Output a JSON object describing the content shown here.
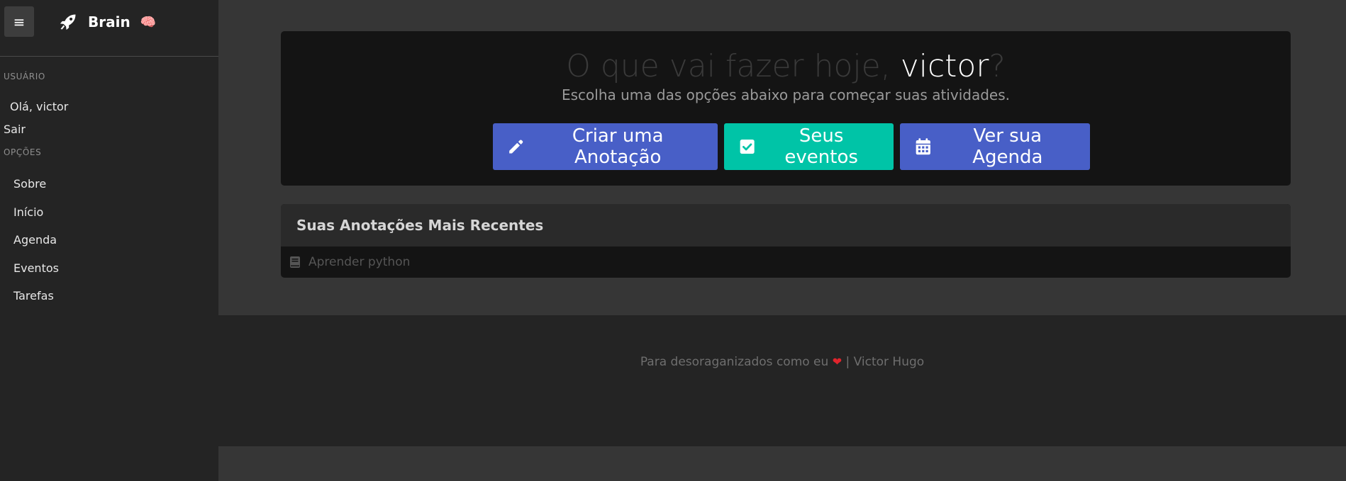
{
  "sidebar": {
    "brand": {
      "title": "Brain",
      "emoji": "🧠"
    },
    "toggle_icon": "≡",
    "user_section_label": "USUÁRIO",
    "greeting": "Olá, victor",
    "logout": "Sair",
    "options_section_label": "OPÇÕES",
    "items": [
      {
        "label": "Sobre"
      },
      {
        "label": "Início"
      },
      {
        "label": "Agenda"
      },
      {
        "label": "Eventos"
      },
      {
        "label": "Tarefas"
      }
    ]
  },
  "hero": {
    "title_prefix": "O que vai fazer hoje, ",
    "user_name": "victor",
    "title_suffix": "?",
    "subtitle": "Escolha uma das opções abaixo para começar suas atividades.",
    "buttons": {
      "note": "Criar uma Anotação",
      "events": "Seus eventos",
      "agenda": "Ver sua Agenda"
    }
  },
  "recent_notes": {
    "title": "Suas Anotações Mais Recentes",
    "items": [
      {
        "label": "Aprender python",
        "icon": "book-icon"
      }
    ]
  },
  "footer": {
    "text": "Para desoraganizados como eu ",
    "heart": "❤",
    "author": " | Victor Hugo"
  },
  "colors": {
    "primary": "#485fc7",
    "success": "#00c4a7",
    "sidebar_bg": "#242424",
    "page_bg": "#363636"
  }
}
